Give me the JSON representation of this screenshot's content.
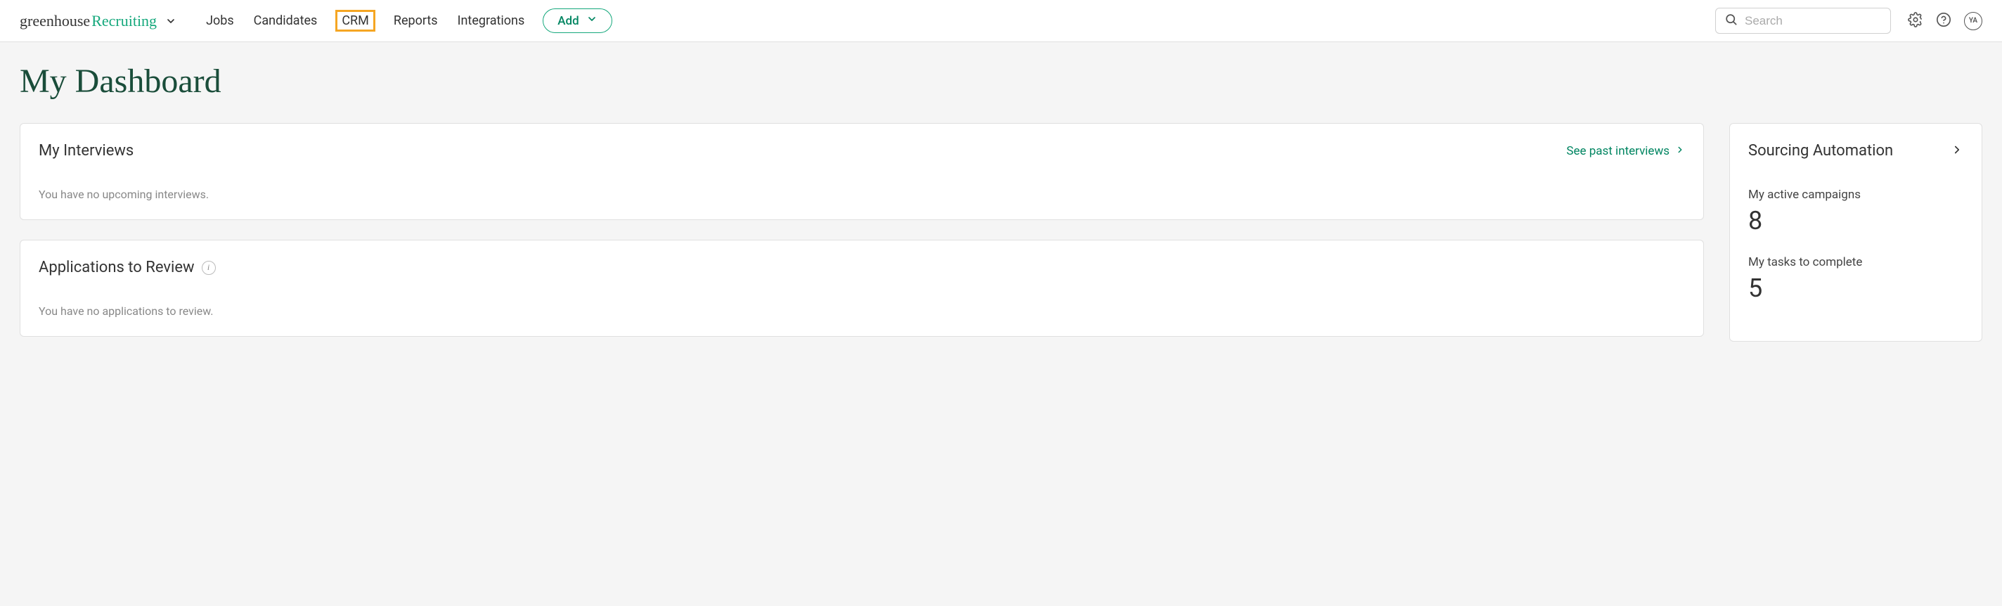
{
  "header": {
    "logo_dark": "greenhouse",
    "logo_accent": "Recruiting",
    "nav": {
      "jobs": "Jobs",
      "candidates": "Candidates",
      "crm": "CRM",
      "reports": "Reports",
      "integrations": "Integrations"
    },
    "add_label": "Add",
    "search_placeholder": "Search",
    "avatar_initials": "YA"
  },
  "page": {
    "title": "My Dashboard"
  },
  "interviews": {
    "title": "My Interviews",
    "link_label": "See past interviews",
    "empty_text": "You have no upcoming interviews."
  },
  "applications": {
    "title": "Applications to Review",
    "empty_text": "You have no applications to review."
  },
  "sourcing": {
    "title": "Sourcing Automation",
    "campaigns_label": "My active campaigns",
    "campaigns_value": "8",
    "tasks_label": "My tasks to complete",
    "tasks_value": "5"
  }
}
